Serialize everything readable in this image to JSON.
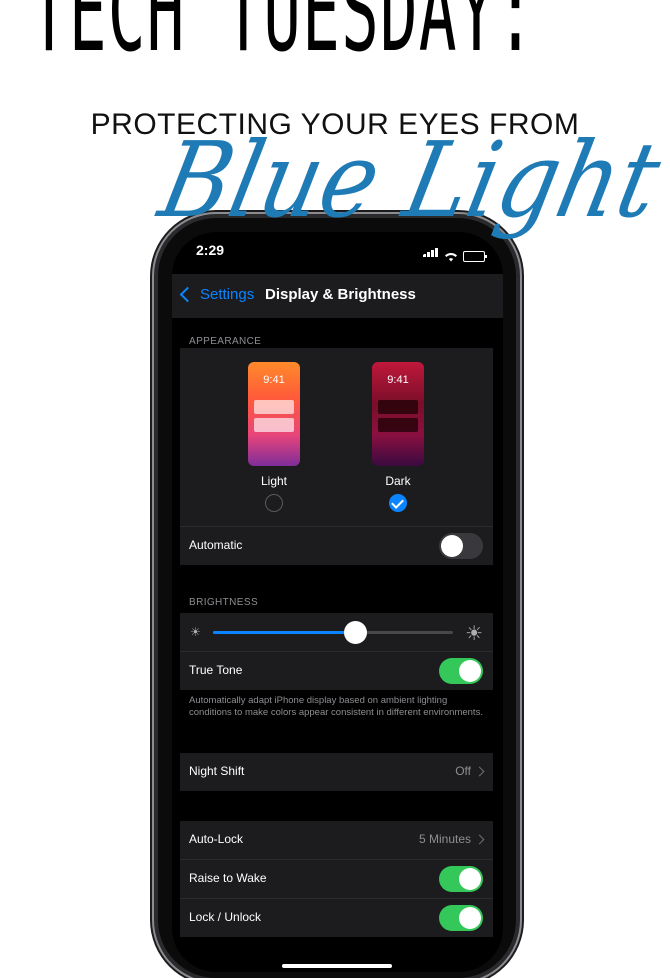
{
  "header": {
    "headline": "TECH TUESDAY:",
    "subheadline": "PROTECTING YOUR EYES FROM",
    "script_title": "Blue Light"
  },
  "status_bar": {
    "time": "2:29"
  },
  "navbar": {
    "back_label": "Settings",
    "title": "Display & Brightness"
  },
  "appearance": {
    "section_header": "APPEARANCE",
    "light": {
      "preview_time": "9:41",
      "label": "Light",
      "selected": false
    },
    "dark": {
      "preview_time": "9:41",
      "label": "Dark",
      "selected": true
    },
    "automatic": {
      "label": "Automatic",
      "on": false
    }
  },
  "brightness": {
    "section_header": "BRIGHTNESS",
    "level": 0.59,
    "true_tone": {
      "label": "True Tone",
      "on": true
    },
    "footnote": "Automatically adapt iPhone display based on ambient lighting conditions to make colors appear consistent in different environments."
  },
  "night_shift": {
    "label": "Night Shift",
    "value": "Off"
  },
  "lock": {
    "auto_lock": {
      "label": "Auto-Lock",
      "value": "5 Minutes"
    },
    "raise_to_wake": {
      "label": "Raise to Wake",
      "on": true
    },
    "lock_unlock": {
      "label": "Lock / Unlock",
      "on": true
    }
  },
  "colors": {
    "accent": "#0a84ff",
    "toggle_on": "#34c759",
    "script": "#1f7bb5"
  }
}
